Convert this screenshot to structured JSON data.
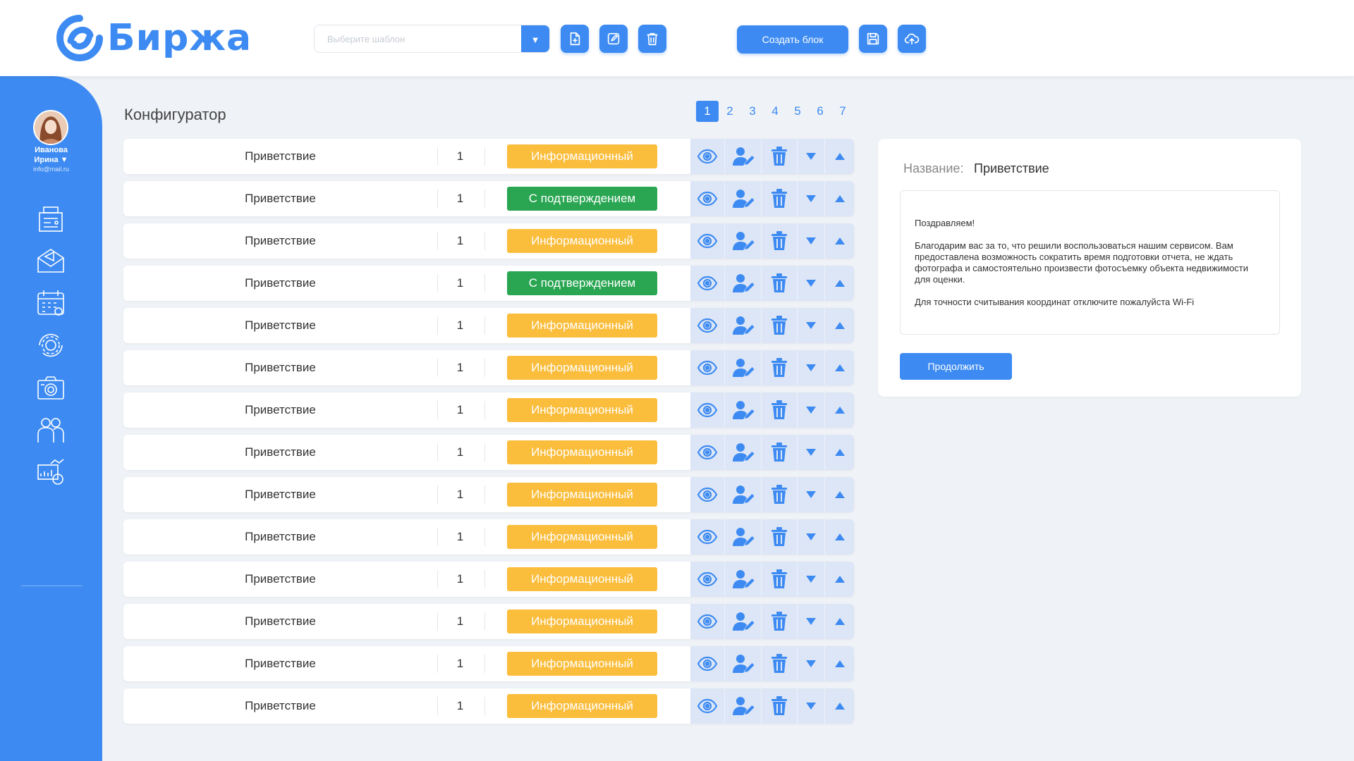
{
  "app": {
    "logo_text": "Биржа",
    "brand_color": "#3d8bf2"
  },
  "header": {
    "template_select": {
      "placeholder": "Выберите шаблон",
      "value": ""
    },
    "create_block_label": "Создать блок",
    "buttons": [
      "add-file-icon",
      "edit-icon",
      "trash-icon",
      "save-icon",
      "cloud-upload-icon"
    ]
  },
  "user": {
    "name": "Иванова\nИрина ▼",
    "name_line1": "Иванова",
    "name_line2": "Ирина ▼",
    "email": "info@mail.ru"
  },
  "sidebar": {
    "icons": [
      "registry-icon",
      "mail-campaign-icon",
      "calendar-icon",
      "settings-cycle-icon",
      "camera-icon",
      "users-icon",
      "analytics-icon"
    ]
  },
  "main": {
    "title": "Конфигуратор",
    "pages": [
      "1",
      "2",
      "3",
      "4",
      "5",
      "6",
      "7"
    ],
    "active_page": "1",
    "rows": [
      {
        "name": "Приветствие",
        "num": "1",
        "type": "Информационный",
        "kind": "info"
      },
      {
        "name": "Приветствие",
        "num": "1",
        "type": "С подтверждением",
        "kind": "confirm"
      },
      {
        "name": "Приветствие",
        "num": "1",
        "type": "Информационный",
        "kind": "info"
      },
      {
        "name": "Приветствие",
        "num": "1",
        "type": "С подтверждением",
        "kind": "confirm"
      },
      {
        "name": "Приветствие",
        "num": "1",
        "type": "Информационный",
        "kind": "info"
      },
      {
        "name": "Приветствие",
        "num": "1",
        "type": "Информационный",
        "kind": "info"
      },
      {
        "name": "Приветствие",
        "num": "1",
        "type": "Информационный",
        "kind": "info"
      },
      {
        "name": "Приветствие",
        "num": "1",
        "type": "Информационный",
        "kind": "info"
      },
      {
        "name": "Приветствие",
        "num": "1",
        "type": "Информационный",
        "kind": "info"
      },
      {
        "name": "Приветствие",
        "num": "1",
        "type": "Информационный",
        "kind": "info"
      },
      {
        "name": "Приветствие",
        "num": "1",
        "type": "Информационный",
        "kind": "info"
      },
      {
        "name": "Приветствие",
        "num": "1",
        "type": "Информационный",
        "kind": "info"
      },
      {
        "name": "Приветствие",
        "num": "1",
        "type": "Информационный",
        "kind": "info"
      },
      {
        "name": "Приветствие",
        "num": "1",
        "type": "Информационный",
        "kind": "info"
      }
    ],
    "row_actions": [
      "eye-icon",
      "user-edit-icon",
      "trash-icon",
      "move-down-icon",
      "move-up-icon"
    ],
    "colors": {
      "info": "#fbbd3c",
      "confirm": "#2aa653"
    }
  },
  "panel": {
    "name_label": "Название:",
    "name_value": "Приветствие",
    "message": {
      "greeting": "Поздравляем!",
      "body": "Благодарим вас за то, что решили воспользоваться нашим сервисом. Вам предоставлена возможность сократить время подготовки отчета, не ждать фотографа и самостоятельно произвести фотосъемку объекта недвижимости для оценки.",
      "note": "Для точности считывания координат отключите пожалуйста Wi-Fi"
    },
    "continue_label": "Продолжить"
  }
}
